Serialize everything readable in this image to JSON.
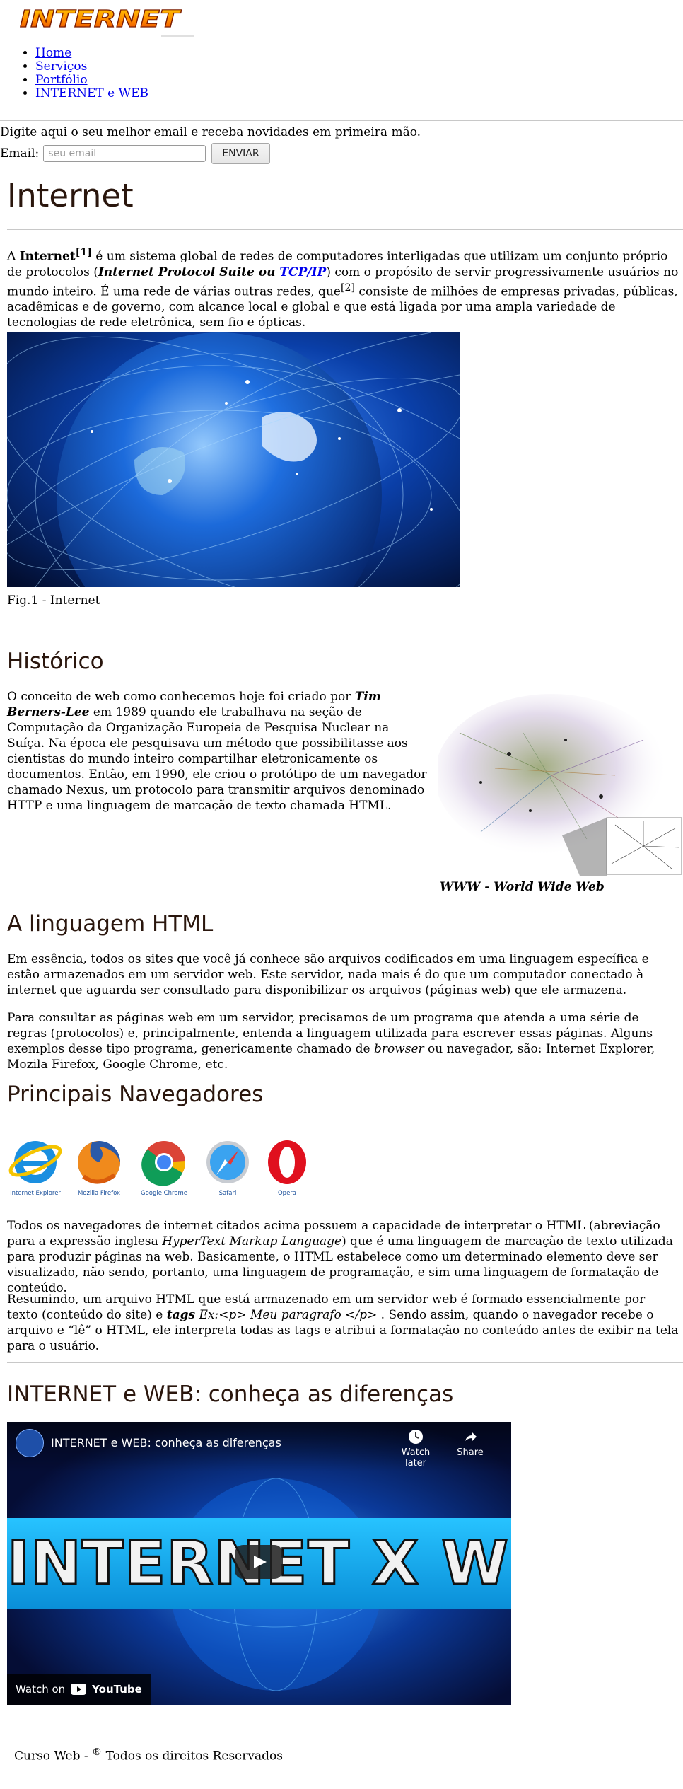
{
  "header": {
    "logo_text": "INTERNET",
    "nav": [
      "Home",
      "Serviços",
      "Portfólio",
      "INTERNET e WEB"
    ]
  },
  "newsletter": {
    "text": "Digite aqui o seu melhor email e receba novidades em primeira mão.",
    "email_label": "Email:",
    "email_placeholder": "seu email",
    "send_label": "ENVIAR"
  },
  "intro": {
    "title": "Internet",
    "p_a": "A ",
    "p_bold": "Internet",
    "p_sup1": "[1]",
    "p_b": " é um sistema global de redes de computadores interligadas que utilizam um conjunto próprio de protocolos (",
    "p_em": "Internet Protocol Suite ou ",
    "p_link": "TCP/IP",
    "p_c": ") com o propósito de servir progressivamente usuários no mundo inteiro. É uma rede de várias outras redes, que",
    "p_sup2": "[2]",
    "p_d": " consiste de milhões de empresas privadas, públicas, acadêmicas e de governo, com alcance local e global e que está ligada por uma ampla variedade de tecnologias de rede eletrônica, sem fio e ópticas.",
    "fig_caption": "Fig.1 - Internet"
  },
  "historico": {
    "title": "Histórico",
    "p_a": "O conceito de web como conhecemos hoje foi criado por ",
    "p_em": "Tim Berners-Lee",
    "p_b": " em 1989 quando ele trabalhava na seção de Computação da Organização Europeia de Pesquisa Nuclear na Suíça. Na época ele pesquisava um método que possibilitasse aos cientistas do mundo inteiro compartilhar eletronicamente os documentos. Então, em 1990, ele criou o protótipo de um navegador chamado Nexus, um protocolo para transmitir arquivos denominado HTTP e uma linguagem de marcação de texto chamada HTML.",
    "fig_caption": "WWW - World Wide Web"
  },
  "html_section": {
    "title": "A linguagem HTML",
    "p1": "Em essência, todos os sites que você já conhece são arquivos codificados em uma linguagem específica e estão armazenados em um servidor web. Este servidor, nada mais é do que um computador conectado à internet que aguarda ser consultado para disponibilizar os arquivos (páginas web) que ele armazena.",
    "p2_a": "Para consultar as páginas web em um servidor, precisamos de um programa que atenda a uma série de regras (protocolos) e, principalmente, entenda a linguagem utilizada para escrever essas páginas. Alguns exemplos desse tipo programa, genericamente chamado de ",
    "p2_em": "browser",
    "p2_b": " ou navegador, são: Internet Explorer, Mozila Firefox, Google Chrome, etc."
  },
  "navegadores": {
    "title": "Principais Navegadores",
    "browsers": [
      "Internet Explorer",
      "Mozilla Firefox",
      "Google Chrome",
      "Safari",
      "Opera"
    ],
    "p1_a": "Todos os navegadores de internet citados acima possuem a capacidade de interpretar o HTML (abreviação para a expressão inglesa ",
    "p1_em": "HyperText Markup Language",
    "p1_b": ") que é uma linguagem de marcação de texto utilizada para produzir páginas na web. Basicamente, o HTML estabelece como um determinado elemento deve ser visualizado, não sendo, portanto, uma linguagem de programação, e sim uma linguagem de formatação de conteúdo.",
    "p2_a": "Resumindo, um arquivo HTML que está armazenado em um servidor web é formado essencialmente por texto (conteúdo do site) e ",
    "p2_tags": "tags",
    "p2_em": " Ex:<p> Meu paragrafo </p>",
    "p2_b": " . Sendo assim, quando o navegador recebe o arquivo e “lê” o HTML, ele interpreta todas as tags e atribui a formatação no conteúdo antes de exibir na tela para o usuário."
  },
  "video_section": {
    "title": "INTERNET e WEB: conheça as diferenças",
    "video_title": "INTERNET e WEB: conheça as diferenças",
    "watch_later": "Watch later",
    "share": "Share",
    "thumb_text": "INTERNET X WEB",
    "watch_on": "Watch on",
    "youtube": "YouTube"
  },
  "footer": {
    "text_a": "Curso Web - ",
    "sup": "®",
    "text_b": " Todos os direitos Reservados"
  }
}
